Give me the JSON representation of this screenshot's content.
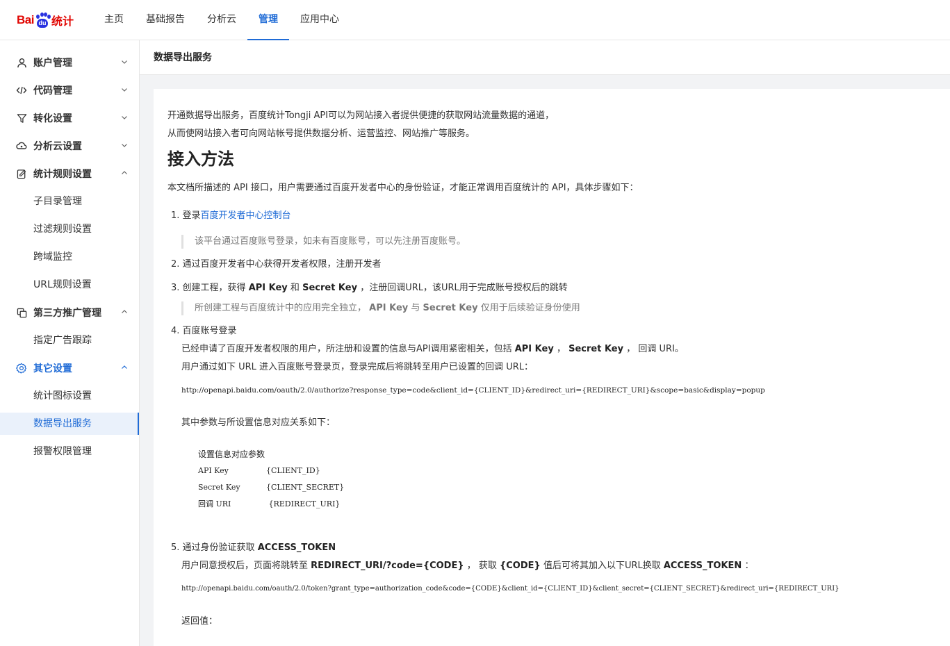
{
  "header": {
    "logo_bai": "Bai",
    "logo_du": "du",
    "logo_tongji": "统计",
    "nav": [
      "主页",
      "基础报告",
      "分析云",
      "管理",
      "应用中心"
    ],
    "active_nav": "管理"
  },
  "sidebar": {
    "groups": [
      {
        "label": "账户管理",
        "icon": "user-icon",
        "expanded": false
      },
      {
        "label": "代码管理",
        "icon": "code-icon",
        "expanded": false
      },
      {
        "label": "转化设置",
        "icon": "filter-icon",
        "expanded": false
      },
      {
        "label": "分析云设置",
        "icon": "cloud-icon",
        "expanded": false
      },
      {
        "label": "统计规则设置",
        "icon": "edit-icon",
        "expanded": true,
        "items": [
          "子目录管理",
          "过滤规则设置",
          "跨域监控",
          "URL规则设置"
        ]
      },
      {
        "label": "第三方推广管理",
        "icon": "copy-icon",
        "expanded": true,
        "items": [
          "指定广告跟踪"
        ]
      },
      {
        "label": "其它设置",
        "icon": "gear-icon",
        "expanded": true,
        "items": [
          "统计图标设置",
          "数据导出服务",
          "报警权限管理"
        ]
      }
    ],
    "active_item": "数据导出服务"
  },
  "main": {
    "title": "数据导出服务",
    "intro1": "开通数据导出服务，百度统计Tongji API可以为网站接入者提供便捷的获取网站流量数据的通道，",
    "intro2": "从而使网站接入者可向网站帐号提供数据分析、运营监控、网站推广等服务。",
    "heading": "接入方法",
    "desc": "本文档所描述的 API 接口，用户需要通过百度开发者中心的身份验证，才能正常调用百度统计的 API，具体步骤如下：",
    "step1_prefix": "1. 登录",
    "step1_link": "百度开发者中心控制台",
    "step1_note": "该平台通过百度账号登录，如未有百度账号，可以先注册百度账号。",
    "step2": "2. 通过百度开发者中心获得开发者权限，注册开发者",
    "step3_a": "3. 创建工程，获得",
    "step3_apikey": "API Key",
    "step3_and": "和",
    "step3_secret": "Secret Key",
    "step3_b": "，注册回调URL，该URL用于完成账号授权后的跳转",
    "step3_note_a": "所创建工程与百度统计中的应用完全独立，",
    "step3_note_apikey": "API Key",
    "step3_note_and": "与",
    "step3_note_secret": "Secret Key",
    "step3_note_b": "仅用于后续验证身份使用",
    "step4": "4. 百度账号登录",
    "step4_line1_a": "已经申请了百度开发者权限的用户，所注册和设置的信息与API调用紧密相关，包括",
    "step4_line1_apikey": "API Key",
    "step4_line1_sep": "，",
    "step4_line1_secret": "Secret Key",
    "step4_line1_b": "， 回调 URI。",
    "step4_line2": "用户通过如下 URL 进入百度账号登录页，登录完成后将跳转至用户已设置的回调 URL：",
    "step4_url": "http://openapi.baidu.com/oauth/2.0/authorize?response_type=code&client_id={CLIENT_ID}&redirect_uri={REDIRECT_URI}&scope=basic&display=popup",
    "step4_params": "其中参数与所设置信息对应关系如下：",
    "table_header": "设置信息对应参数",
    "table_rows": [
      {
        "k": "API Key",
        "v": "{CLIENT_ID}"
      },
      {
        "k": "Secret Key",
        "v": "{CLIENT_SECRET}"
      },
      {
        "k": "回调 URI",
        "v": " {REDIRECT_URI}"
      }
    ],
    "step5_a": "5. 通过身份验证获取",
    "step5_token": "ACCESS_TOKEN",
    "step5_line1_a": "用户同意授权后，页面将跳转至",
    "step5_line1_redirect": "REDIRECT_URI/?code={CODE}",
    "step5_line1_b": "， 获取",
    "step5_line1_code": "{CODE}",
    "step5_line1_c": "值后可将其加入以下URL换取",
    "step5_line1_token": "ACCESS_TOKEN",
    "step5_line1_d": "：",
    "step5_url": "http://openapi.baidu.com/oauth/2.0/token?grant_type=authorization_code&code={CODE}&client_id={CLIENT_ID}&client_secret={CLIENT_SECRET}&redirect_uri={REDIRECT_URI}",
    "return_label": "返回值："
  }
}
